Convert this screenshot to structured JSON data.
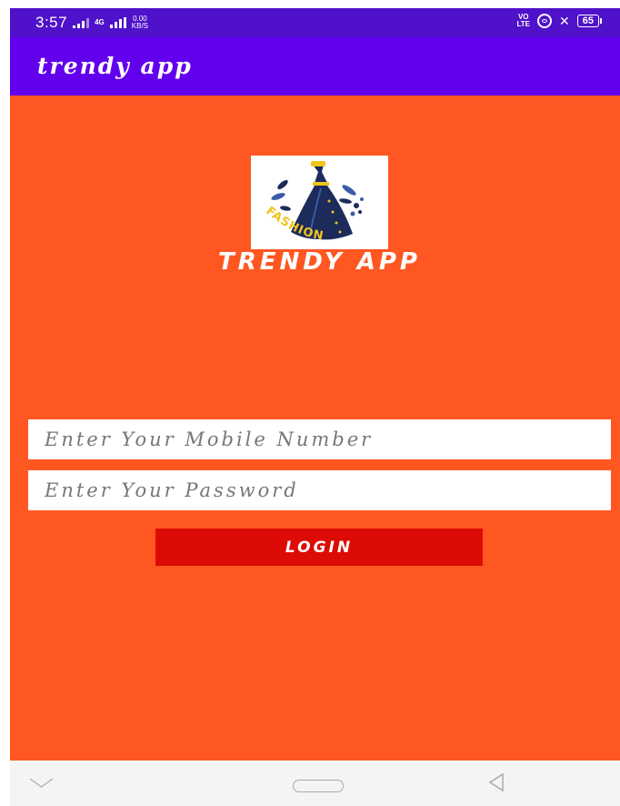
{
  "status_bar": {
    "time": "3:57",
    "network_type": "4G",
    "net_speed_value": "0.00",
    "net_speed_unit": "KB/S",
    "volte_top": "VO",
    "volte_bottom": "LTE",
    "battery": "65"
  },
  "toolbar": {
    "title": "trendy app"
  },
  "logo": {
    "text": "FASHION",
    "app_name": "TRENDY APP"
  },
  "form": {
    "mobile_placeholder": "Enter Your Mobile Number",
    "password_placeholder": "Enter Your Password",
    "login_label": "LOGIN"
  },
  "colors": {
    "status_bar": "#4f11c9",
    "toolbar": "#6200ee",
    "background": "#ff5722",
    "login_button": "#dd0b05"
  },
  "icons": {
    "status": [
      "signal-icon",
      "data-icon",
      "hotspot-icon",
      "mute-icon",
      "battery-icon"
    ],
    "nav": [
      "nav-down-icon",
      "home-icon",
      "back-icon"
    ]
  }
}
